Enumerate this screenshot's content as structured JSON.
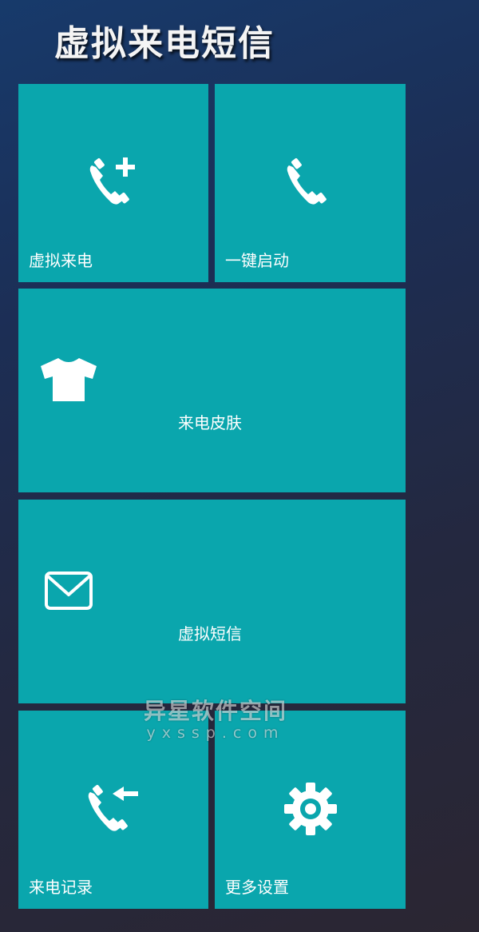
{
  "app": {
    "title": "虚拟来电短信"
  },
  "tiles": [
    {
      "id": "fake-call",
      "label": "虚拟来电",
      "icon": "phone-add-icon"
    },
    {
      "id": "one-key-start",
      "label": "一键启动",
      "icon": "phone-icon"
    },
    {
      "id": "call-skin",
      "label": "来电皮肤",
      "icon": "tshirt-icon"
    },
    {
      "id": "fake-sms",
      "label": "虚拟短信",
      "icon": "envelope-icon"
    },
    {
      "id": "call-log",
      "label": "来电记录",
      "icon": "phone-incoming-icon"
    },
    {
      "id": "more-settings",
      "label": "更多设置",
      "icon": "gear-icon"
    }
  ],
  "watermark": {
    "main": "异星软件空间",
    "sub": "yxssp.com"
  },
  "colors": {
    "tile": "#0aa6ad",
    "icon": "#ffffff",
    "background_top": "#173a6b",
    "background_bottom": "#2b2632"
  }
}
